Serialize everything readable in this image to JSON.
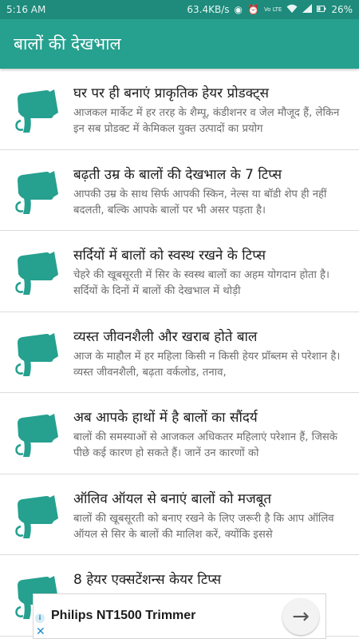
{
  "status_bar": {
    "time": "5:16 AM",
    "network_speed": "63.4KB/s",
    "battery": "26%",
    "icons": [
      "eye-icon",
      "alarm-icon",
      "volte-icon",
      "wifi-icon",
      "signal-icon",
      "battery-icon"
    ],
    "volte_label": "Vo LTE"
  },
  "app_bar": {
    "title": "बालों की देखभाल"
  },
  "colors": {
    "app_bar": "#26a08f",
    "status_bar": "#1e8b7c",
    "icon": "#26a08f"
  },
  "items": [
    {
      "icon": "hair-dryer-icon",
      "title": "घर पर ही बनाएं प्राकृतिक हेयर प्रोडक्ट्स",
      "description": "आजकल मार्केट में हर तरह के शैम्पू, कंडीशनर व जेल मौजूद हैं, लेकिन इन सब प्रोडक्ट में केमिकल युक्त उत्पादों का प्रयोग"
    },
    {
      "icon": "hair-dryer-icon",
      "title": "बढ़ती उम्र के बालों की देखभाल के 7 टिप्स",
      "description": "आपकी उम्र के साथ सिर्फ आपकी स्किन, नेल्स या बॉडी शेप ही नहीं बदलती, बल्कि आपके बालों पर भी असर पड़ता है।"
    },
    {
      "icon": "hair-dryer-icon",
      "title": "सर्दियों में बालों को स्वस्थ रखने के टिप्स",
      "description": "चेहरे की खूबसूरती में सिर के स्वस्थ बालों का अहम योगदान होता है। सर्दियों के दिनों में बालों की देखभाल में थोड़ी"
    },
    {
      "icon": "hair-dryer-icon",
      "title": "व्यस्त जीवनशैली और खराब होते बाल",
      "description": "आज के माहौल में हर महिला किसी न किसी हेयर प्रॉब्लम से परेशान है। व्यस्त जीवनशैली, बढ़ता वर्कलोड, तनाव,"
    },
    {
      "icon": "hair-dryer-icon",
      "title": "अब आपके हाथों में है बालों का सौंदर्य",
      "description": "बालों की समस्याओं से आजकल अधिकतर महिलाएं परेशान हैं, जिसके पीछे कई कारण हो सकते हैं। जानें उन कारणों को"
    },
    {
      "icon": "hair-dryer-icon",
      "title": "ऑलिव ऑयल से बनाएं बालों को मजबूत",
      "description": "बालों की खूबसूरती को बनाए रखने के लिए जरूरी है कि आप ऑलिव ऑयल से सिर के बालों की मालिश करें, क्योंकि इससे"
    },
    {
      "icon": "hair-dryer-icon",
      "title": "8 हेयर एक्सटेंशन्स केयर टिप्स",
      "description": ""
    }
  ],
  "ad": {
    "title": "Philips NT1500 Trimmer",
    "info_label": "i",
    "close_label": "✕",
    "arrow_label": "→"
  }
}
